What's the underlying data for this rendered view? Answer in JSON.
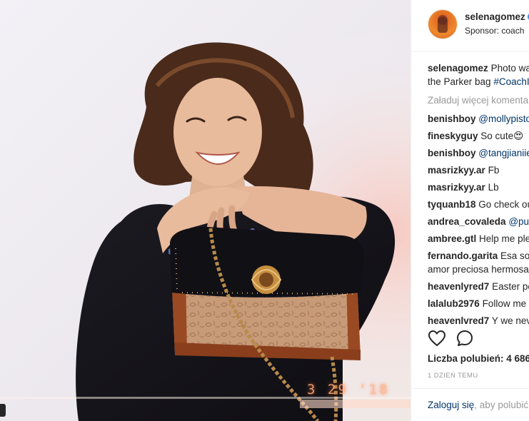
{
  "post": {
    "username": "selenagomez",
    "sponsor_text": "Sponsor: coach",
    "photo_date_stamp": "3 29 '18"
  },
  "caption": {
    "username": "selenagomez",
    "text_line1": "Photo wa",
    "text_line2_prefix": "the Parker bag",
    "hashtag": "#CoachI"
  },
  "load_more_label": "Załaduj więcej komenta",
  "comments": [
    {
      "user": "benishboy",
      "text": "@mollypisto",
      "mention": true
    },
    {
      "user": "fineskyguy",
      "text": "So cute😍",
      "mention": false
    },
    {
      "user": "benishboy",
      "text": "@tangjianiie",
      "mention": true
    },
    {
      "user": "masrizkyy.ar",
      "text": "Fb",
      "mention": false
    },
    {
      "user": "masrizkyy.ar",
      "text": "Lb",
      "mention": false
    },
    {
      "user": "tyquanb18",
      "text": "Go check ou",
      "mention": false
    },
    {
      "user": "andrea_covaleda",
      "text": "@pul",
      "mention": true
    },
    {
      "user": "ambree.gtl",
      "text": "Help me ple",
      "mention": false
    },
    {
      "user": "fernando.garita",
      "text": "Esa sor",
      "text2": "amor preciosa hermosa",
      "mention": false
    },
    {
      "user": "heavenlyred7",
      "text": "Easter pe",
      "mention": false
    },
    {
      "user": "lalalub2976",
      "text": "Follow me",
      "mention": false
    },
    {
      "user": "heavenlvred7",
      "text": "Y we nev",
      "mention": false
    }
  ],
  "likes_text": "Liczba polubień: 4 686",
  "timestamp": "1 DZIEŃ TEMU",
  "login": {
    "link": "Zaloguj się",
    "rest": ", aby polubić"
  },
  "colors": {
    "link": "#003569",
    "muted": "#999999",
    "verified": "#3897f0"
  },
  "icons": [
    "heart-icon",
    "comment-icon",
    "verified-icon"
  ]
}
